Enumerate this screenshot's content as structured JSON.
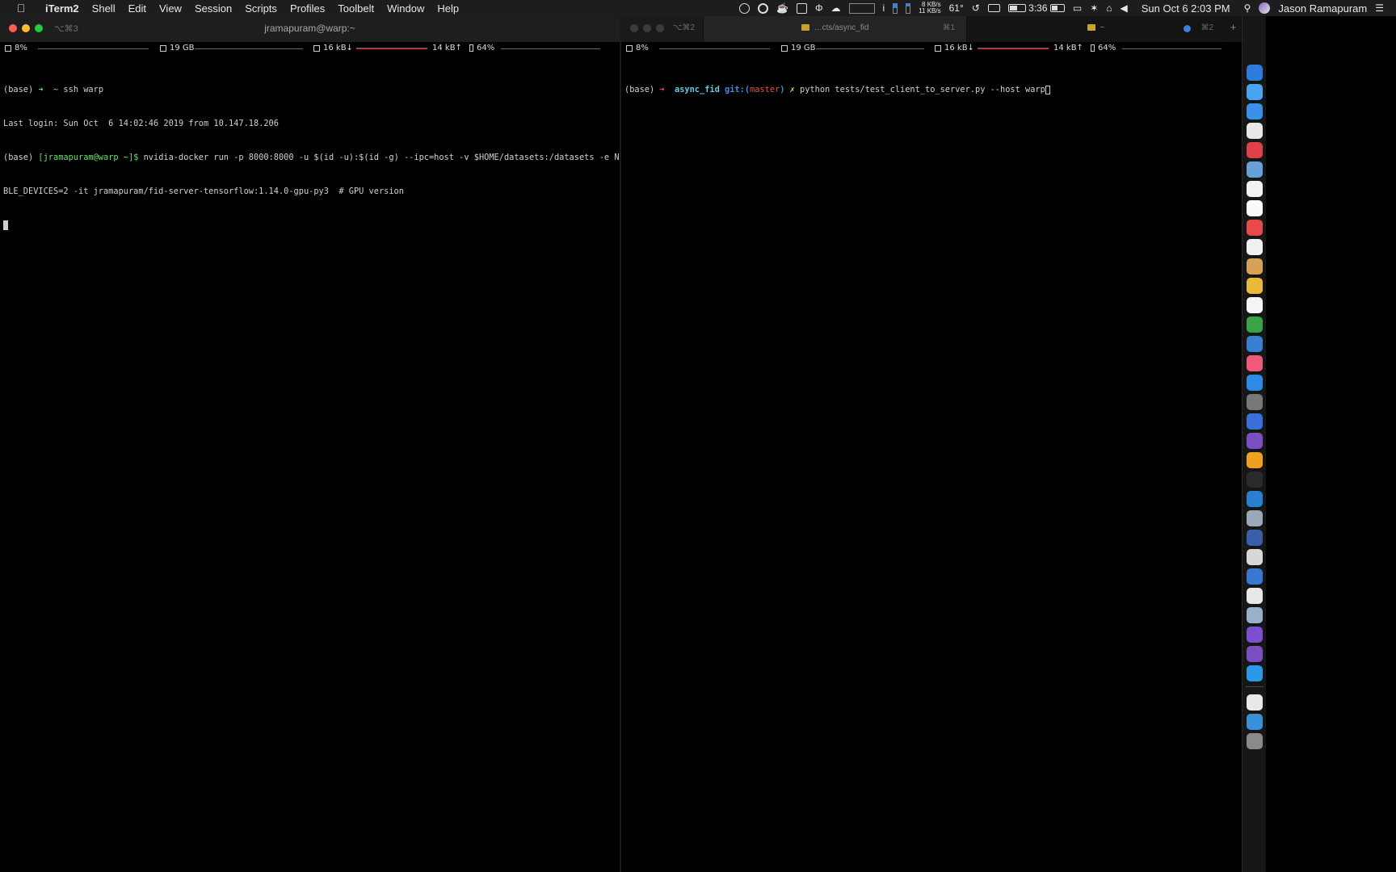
{
  "menubar": {
    "apple_glyph": "",
    "menus": [
      "iTerm2",
      "Shell",
      "Edit",
      "View",
      "Session",
      "Scripts",
      "Profiles",
      "Toolbelt",
      "Window",
      "Help"
    ],
    "net_up": "8 KB/s",
    "net_down": "11 KB/s",
    "temperature": "61°",
    "battery_time": "3:36",
    "clock": "Sun Oct 6  2:03 PM",
    "user": "Jason Ramapuram",
    "icons": [
      "record-icon",
      "1password-icon",
      "coffee-icon",
      "adobe-icon",
      "phi-icon",
      "cloud-upload-icon",
      "cpu-gauge-icon",
      "info-icon",
      "memory-gauge-icon",
      "disk-gauge-icon",
      "network-speed-icon",
      "temperature-icon",
      "time-machine-icon",
      "keyboard-icon",
      "battery-icon",
      "airplay-icon",
      "bluetooth-icon",
      "wifi-icon",
      "volume-icon",
      "spotlight-icon",
      "siri-icon",
      "notification-center-icon"
    ]
  },
  "left_pane": {
    "shortcut": "⌥⌘3",
    "title": "jramapuram@warp:~",
    "status": {
      "cpu": "8%",
      "memory": "19 GB",
      "net_down": "16 kB↓",
      "net_up": "14 kB↑",
      "battery": "64%"
    },
    "lines": {
      "l1_prompt": "(base) ",
      "l1_arrow": "➜",
      "l1_dir": "  ~ ",
      "l1_cmd": "ssh warp",
      "l2": "Last login: Sun Oct  6 14:02:46 2019 from 10.147.18.206",
      "l3_base": "(base) ",
      "l3_user": "[jramapuram@warp ~]$",
      "l3_cmd": " nvidia-docker run -p 8000:8000 -u $(id -u):$(id -g) --ipc=host -v $HOME/datasets:/datasets -e NVIDIA_VISI",
      "l4": "BLE_DEVICES=2 -it jramapuram/fid-server-tensorflow:1.14.0-gpu-py3  # GPU version"
    }
  },
  "right_pane": {
    "tabs": [
      {
        "label": "",
        "key": "⌥⌘2"
      },
      {
        "label": "…cts/async_fid",
        "key": "⌘1"
      },
      {
        "label": "~",
        "key": "⌘2"
      }
    ],
    "status": {
      "cpu": "8%",
      "memory": "19 GB",
      "net_down": "16 kB↓",
      "net_up": "14 kB↑",
      "battery": "64%"
    },
    "lines": {
      "p_base": "(base) ",
      "p_arrow": "➜",
      "p_dir": "  async_fid ",
      "p_git": "git:(",
      "p_branch": "master",
      "p_git_close": ")",
      "p_x": " ✗ ",
      "p_cmd": "python tests/test_client_to_server.py --host warp"
    }
  },
  "dock": {
    "apps": [
      "finder-icon",
      "messages-icon",
      "safari-icon",
      "chrome-icon",
      "pocket-icon",
      "preview-icon",
      "calendar-icon",
      "notes-icon",
      "news-icon",
      "reminders-icon",
      "photos-app-icon",
      "photos-icon",
      "textedit-icon",
      "numbers-icon",
      "keynote-icon",
      "music-icon",
      "app-store-icon",
      "system-preferences-icon",
      "pencil-icon",
      "emacs-icon",
      "sublime-icon",
      "terminal-icon",
      "vscode-icon",
      "scanner-icon",
      "screen-icon",
      "slack-icon",
      "transmit-icon",
      "aperture-icon",
      "image-capture-icon",
      "dash-icon",
      "emacs-alt-icon",
      "edge-icon",
      "1password-app-icon",
      "downloads-folder-icon",
      "trash-icon"
    ]
  }
}
